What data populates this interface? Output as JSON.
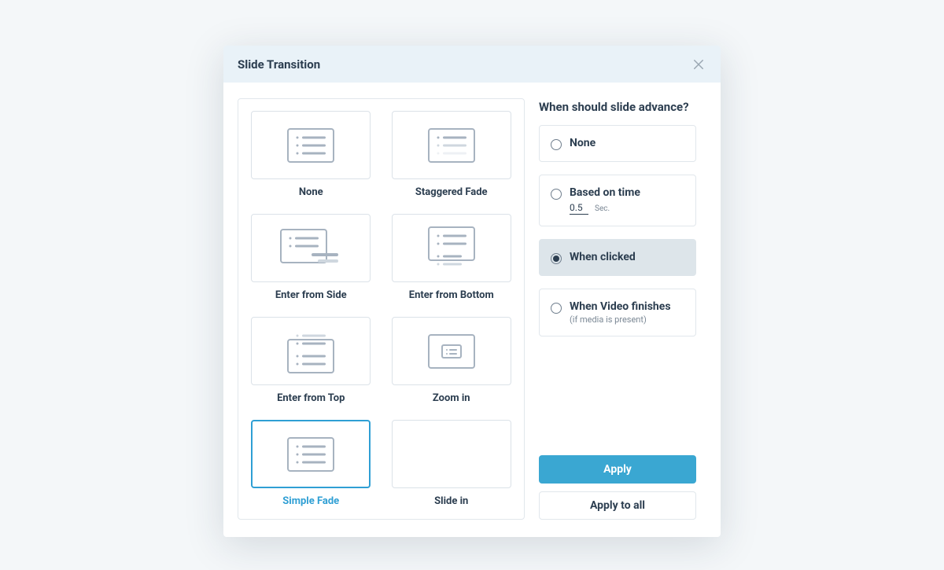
{
  "dialog": {
    "title": "Slide Transition",
    "close_icon_name": "close-icon"
  },
  "transitions": [
    {
      "id": "none",
      "label": "None",
      "selected": false
    },
    {
      "id": "staggered-fade",
      "label": "Staggered Fade",
      "selected": false
    },
    {
      "id": "enter-from-side",
      "label": "Enter from Side",
      "selected": false
    },
    {
      "id": "enter-from-bottom",
      "label": "Enter from Bottom",
      "selected": false
    },
    {
      "id": "enter-from-top",
      "label": "Enter from Top",
      "selected": false
    },
    {
      "id": "zoom-in",
      "label": "Zoom in",
      "selected": false
    },
    {
      "id": "simple-fade",
      "label": "Simple Fade",
      "selected": true
    },
    {
      "id": "slide-in",
      "label": "Slide in",
      "selected": false
    }
  ],
  "advance": {
    "title": "When should slide advance?",
    "options": [
      {
        "id": "none",
        "label": "None",
        "selected": false
      },
      {
        "id": "time",
        "label": "Based on time",
        "selected": false,
        "time_value": "0.5",
        "time_unit": "Sec."
      },
      {
        "id": "click",
        "label": "When clicked",
        "selected": true
      },
      {
        "id": "video",
        "label": "When Video finishes",
        "selected": false,
        "sub": "(if media is present)"
      }
    ]
  },
  "buttons": {
    "apply": "Apply",
    "apply_all": "Apply to all"
  },
  "colors": {
    "accent": "#3aa7d2",
    "header_bg": "#e9f2f8",
    "line": "#dbe2e8"
  }
}
